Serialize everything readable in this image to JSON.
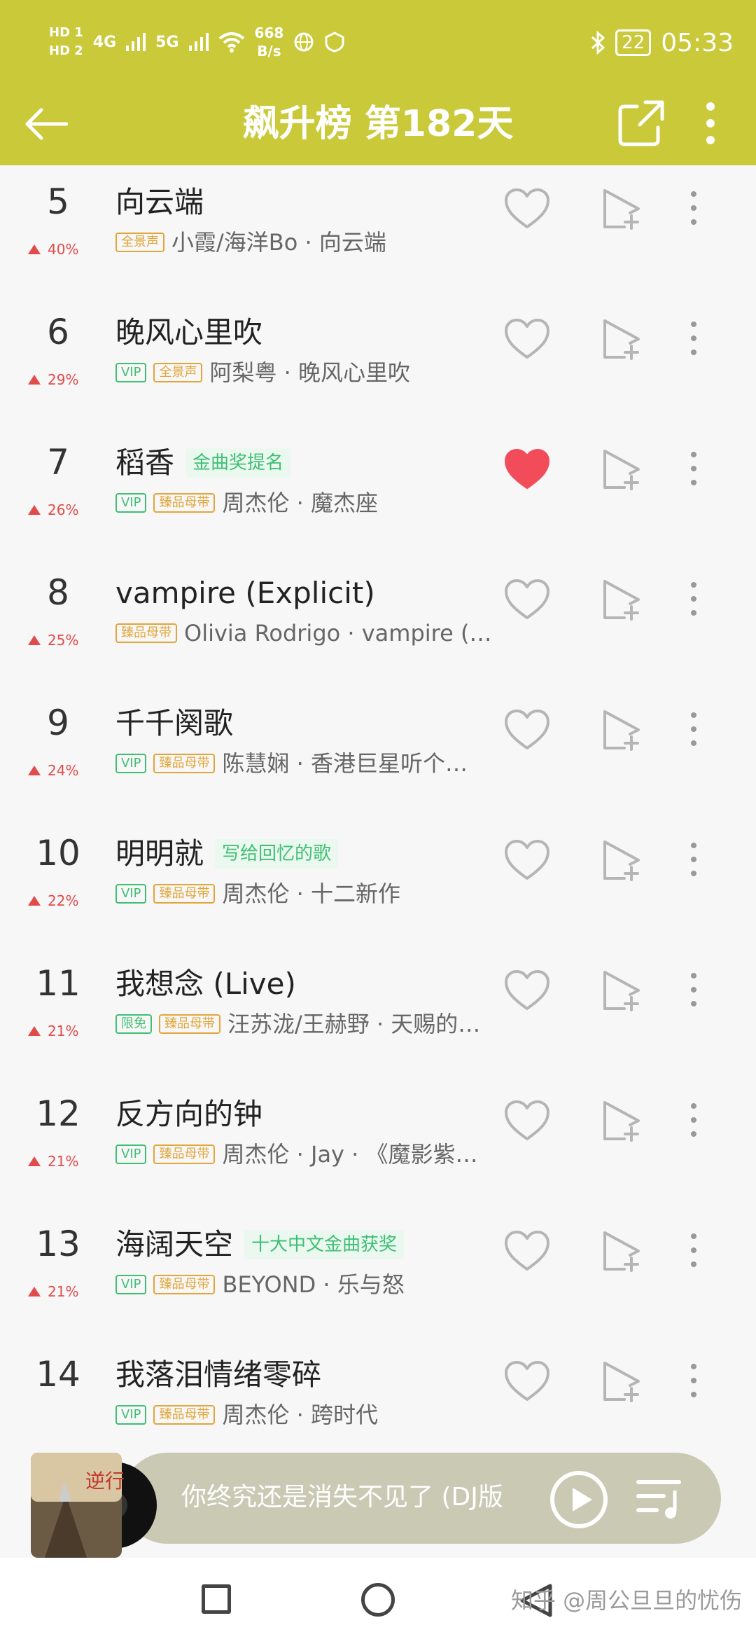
{
  "status_bar": {
    "hd1": "HD 1",
    "hd2": "HD 2",
    "net_4g": "4G",
    "net_5g": "5G",
    "speed_value": "668",
    "speed_unit": "B/s",
    "battery": "22",
    "time": "05:33"
  },
  "header": {
    "title": "飙升榜 第182天"
  },
  "songs": [
    {
      "rank": "5",
      "trend": "40%",
      "title": "向云端",
      "award": "",
      "badges": [
        "全景声"
      ],
      "artist": "小霞/海洋Bo · 向云端",
      "liked": false
    },
    {
      "rank": "6",
      "trend": "29%",
      "title": "晚风心里吹",
      "award": "",
      "badges": [
        "VIP",
        "全景声"
      ],
      "artist": "阿梨粤 · 晚风心里吹",
      "liked": false
    },
    {
      "rank": "7",
      "trend": "26%",
      "title": "稻香",
      "award": "金曲奖提名",
      "badges": [
        "VIP",
        "臻品母带"
      ],
      "artist": "周杰伦 · 魔杰座",
      "liked": true
    },
    {
      "rank": "8",
      "trend": "25%",
      "title": "vampire (Explicit)",
      "award": "",
      "badges": [
        "臻品母带"
      ],
      "artist": "Olivia Rodrigo · vampire (…",
      "liked": false
    },
    {
      "rank": "9",
      "trend": "24%",
      "title": "千千阕歌",
      "award": "",
      "badges": [
        "VIP",
        "臻品母带"
      ],
      "artist": "陈慧娴 · 香港巨星听个…",
      "liked": false
    },
    {
      "rank": "10",
      "trend": "22%",
      "title": "明明就",
      "award": "写给回忆的歌",
      "badges": [
        "VIP",
        "臻品母带"
      ],
      "artist": "周杰伦 · 十二新作",
      "liked": false
    },
    {
      "rank": "11",
      "trend": "21%",
      "title": "我想念 (Live)",
      "award": "",
      "badges": [
        "限免",
        "臻品母带"
      ],
      "artist": "汪苏泷/王赫野 · 天赐的…",
      "liked": false
    },
    {
      "rank": "12",
      "trend": "21%",
      "title": "反方向的钟",
      "award": "",
      "badges": [
        "VIP",
        "臻品母带"
      ],
      "artist": "周杰伦 · Jay · 《魔影紫…",
      "liked": false
    },
    {
      "rank": "13",
      "trend": "21%",
      "title": "海阔天空",
      "award": "十大中文金曲获奖",
      "badges": [
        "VIP",
        "臻品母带"
      ],
      "artist": "BEYOND · 乐与怒",
      "liked": false
    },
    {
      "rank": "14",
      "trend": "",
      "title": "我落泪情绪零碎",
      "award": "",
      "badges": [
        "VIP",
        "臻品母带"
      ],
      "artist": "周杰伦 · 跨时代",
      "liked": false
    }
  ],
  "player": {
    "cover_text": "逆行",
    "now_playing": "你终究还是消失不见了 (DJ版"
  },
  "watermark": "知乎 @周公旦旦的忧伤",
  "colors": {
    "header_bg": "#c9c93a",
    "liked": "#f24c5a",
    "trend_up": "#e24b4b",
    "vip_green": "#3fbf74",
    "gold": "#e2a53a"
  },
  "icons": {
    "back": "arrow-left-icon",
    "share": "share-external-icon",
    "more": "more-vertical-icon",
    "heart": "heart-icon",
    "add_to_playlist": "add-to-playlist-icon",
    "play": "play-icon",
    "playlist": "playlist-icon"
  }
}
